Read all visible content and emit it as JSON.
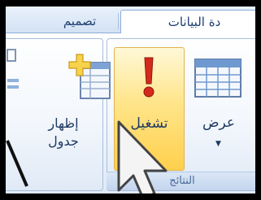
{
  "tabs": {
    "design_label": "تصميم",
    "database_tools_label": "دة البيانات"
  },
  "groups": {
    "results_label": "النتائج"
  },
  "buttons": {
    "run_label": "تشغيل",
    "view_label": "عرض",
    "show_table_line1": "إظهار",
    "show_table_line2": "جدول"
  },
  "icons": {
    "run": "exclamation-icon",
    "view": "datasheet-grid-icon",
    "show_table": "add-table-icon",
    "cursor": "mouse-pointer-icon"
  },
  "colors": {
    "run_highlight": "#ffd04c",
    "exclamation": "#d42a1c",
    "text": "#1f3a64"
  }
}
